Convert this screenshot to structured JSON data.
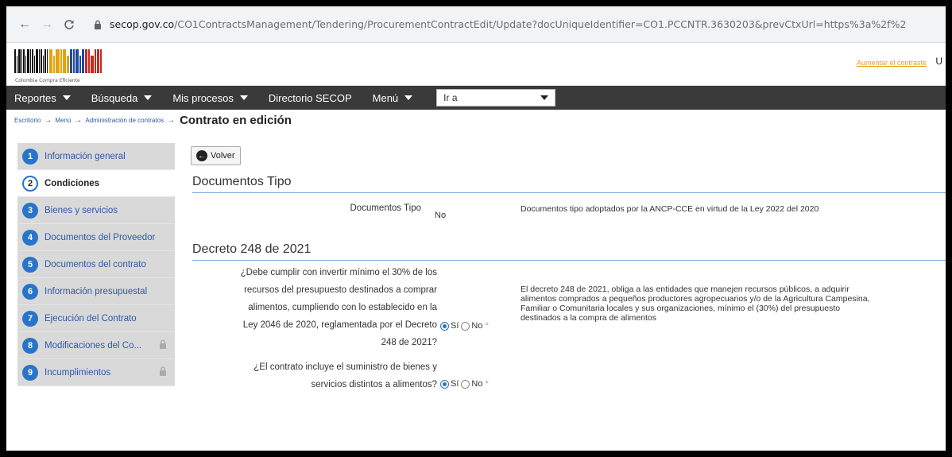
{
  "browser": {
    "back_icon": "arrow-left",
    "forward_icon": "arrow-right",
    "reload_icon": "reload",
    "url_host": "secop.gov.co",
    "url_path": "/CO1ContractsManagement/Tendering/ProcurementContractEdit/Update?docUniqueIdentifier=CO1.PCCNTR.3630203&prevCtxUrl=https%3a%2f%2"
  },
  "header": {
    "logo_caption": "Colombia Compra Eficiente",
    "link_text": "Aumentar el contraste",
    "user_initial": "U",
    "logo_colors": [
      "#111111",
      "#e2a30f",
      "#1f4aa0",
      "#c5281c"
    ]
  },
  "menubar": {
    "items": [
      {
        "label": "Reportes",
        "dropdown": true
      },
      {
        "label": "Búsqueda",
        "dropdown": true
      },
      {
        "label": "Mis procesos",
        "dropdown": true
      },
      {
        "label": "Directorio SECOP",
        "dropdown": false
      },
      {
        "label": "Menú",
        "dropdown": true
      }
    ],
    "goto_value": "Ir a"
  },
  "breadcrumb": {
    "items": [
      "Escritorio",
      "Menú",
      "Administración de contratos"
    ],
    "current": "Contrato en edición"
  },
  "sidebar": {
    "steps": [
      {
        "num": "1",
        "label": "Información general",
        "active": false,
        "locked": false
      },
      {
        "num": "2",
        "label": "Condiciones",
        "active": true,
        "locked": false
      },
      {
        "num": "3",
        "label": "Bienes y servicios",
        "active": false,
        "locked": false
      },
      {
        "num": "4",
        "label": "Documentos del Proveedor",
        "active": false,
        "locked": false
      },
      {
        "num": "5",
        "label": "Documentos del contrato",
        "active": false,
        "locked": false
      },
      {
        "num": "6",
        "label": "Información presupuestal",
        "active": false,
        "locked": false
      },
      {
        "num": "7",
        "label": "Ejecución del Contrato",
        "active": false,
        "locked": false
      },
      {
        "num": "8",
        "label": "Modificaciones del Co...",
        "active": false,
        "locked": true
      },
      {
        "num": "9",
        "label": "Incumplimientos",
        "active": false,
        "locked": true
      }
    ]
  },
  "main": {
    "back_button": "Volver",
    "sections": {
      "documentos_tipo": {
        "title": "Documentos Tipo",
        "field_label": "Documentos Tipo",
        "field_value": "No",
        "help": "Documentos tipo adoptados por la ANCP-CCE en virtud de la Ley 2022 del 2020"
      },
      "decreto": {
        "title": "Decreto 248 de 2021",
        "q1_lines": [
          "¿Debe cumplir con invertir mínimo el 30% de los",
          "recursos del presupuesto destinados a comprar",
          "alimentos, cumpliendo con lo establecido en la",
          "Ley 2046 de 2020, reglamentada por el Decreto",
          "248 de 2021?"
        ],
        "q1_yes": "Sí",
        "q1_no": "No",
        "q1_selected": "Sí",
        "help": "El decreto 248 de 2021, obliga a las entidades que manejen recursos públicos, a adquirir alimentos comprados a pequeños productores agropecuarios y/o de la Agricultura Campesina, Familiar o Comunitaria locales y sus organizaciones, mínimo el (30%) del presupuesto destinados a la compra de alimentos",
        "q2_lines": [
          "¿El contrato incluye el suministro de bienes y",
          "servicios distintos a alimentos?"
        ],
        "q2_yes": "Sí",
        "q2_no": "No",
        "q2_selected": "Sí",
        "required_mark": "*"
      }
    }
  }
}
